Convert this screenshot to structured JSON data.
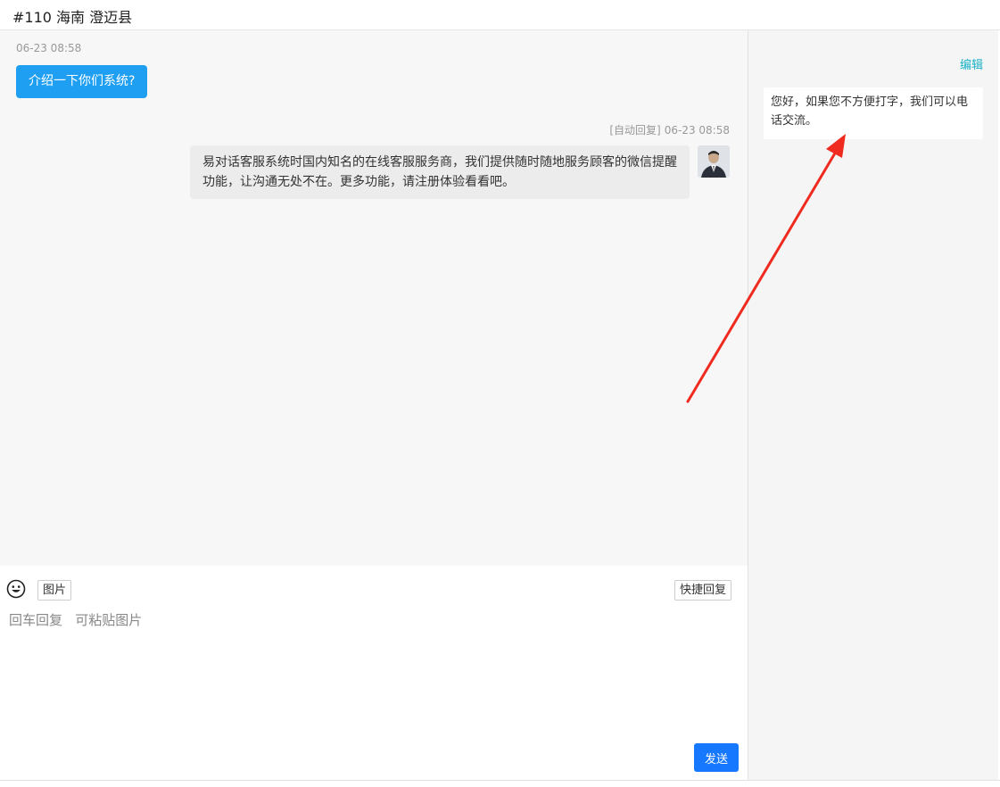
{
  "header": {
    "title": "#110 海南 澄迈县"
  },
  "chat": {
    "messages": [
      {
        "time": "06-23 08:58",
        "text": "介绍一下你们系统?"
      },
      {
        "auto_tag": "[自动回复]",
        "time": "06-23 08:58",
        "text": "易对话客服系统时国内知名的在线客服服务商，我们提供随时随地服务顾客的微信提醒功能，让沟通无处不在。更多功能，请注册体验看看吧。",
        "avatar_icon": "agent-avatar-icon"
      }
    ]
  },
  "composer": {
    "emoji_icon": "smiley-icon",
    "image_button": "图片",
    "quick_reply_button": "快捷回复",
    "input_placeholder": "回车回复   可粘贴图片",
    "send_button": "发送"
  },
  "side_panel": {
    "edit_link": "编辑",
    "quick_replies": [
      {
        "text": "您好，如果您不方便打字，我们可以电话交流。"
      }
    ]
  },
  "colors": {
    "user_bubble": "#1e9ff2",
    "send_button": "#1677ff",
    "edit_link": "#1ab2c7",
    "annotation_arrow": "#f02a1e"
  }
}
